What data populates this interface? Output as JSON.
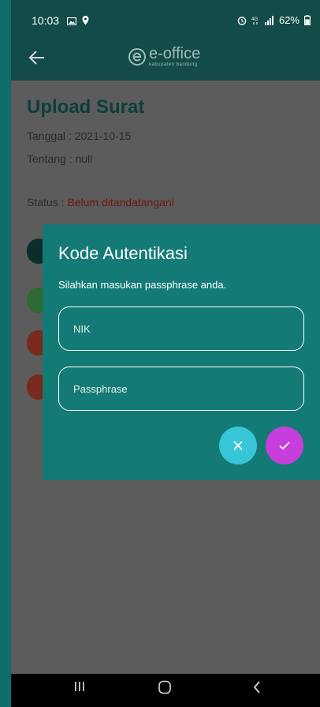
{
  "status_bar": {
    "time": "10:03",
    "icons_left": [
      "image-icon",
      "location-pin-icon"
    ],
    "icons_right": [
      "alarm-icon",
      "4g-icon",
      "signal-icon"
    ],
    "battery": "62%"
  },
  "app_bar": {
    "back_icon": "arrow-left-icon",
    "logo_main": "e-office",
    "logo_sub": "kabupaten bandung"
  },
  "document": {
    "title": "Upload Surat",
    "tanggal": "Tanggal : 2021-10-15",
    "tentang": "Tentang : null",
    "status_label": "Status : ",
    "status_value": "Belum ditandatangani"
  },
  "dialog": {
    "title": "Kode Autentikasi",
    "message": "Silahkan masukan passphrase anda.",
    "nik_placeholder": "NIK",
    "passphrase_placeholder": "Passphrase",
    "cancel_icon": "close-icon",
    "confirm_icon": "check-icon"
  },
  "colors": {
    "header": "#124b47",
    "dialog": "#147a76",
    "cancel": "#36c6d8",
    "confirm": "#c63fdc",
    "status_value": "#701414"
  },
  "nav_bar": {
    "icons": [
      "recent-apps-icon",
      "home-icon",
      "back-icon"
    ]
  }
}
